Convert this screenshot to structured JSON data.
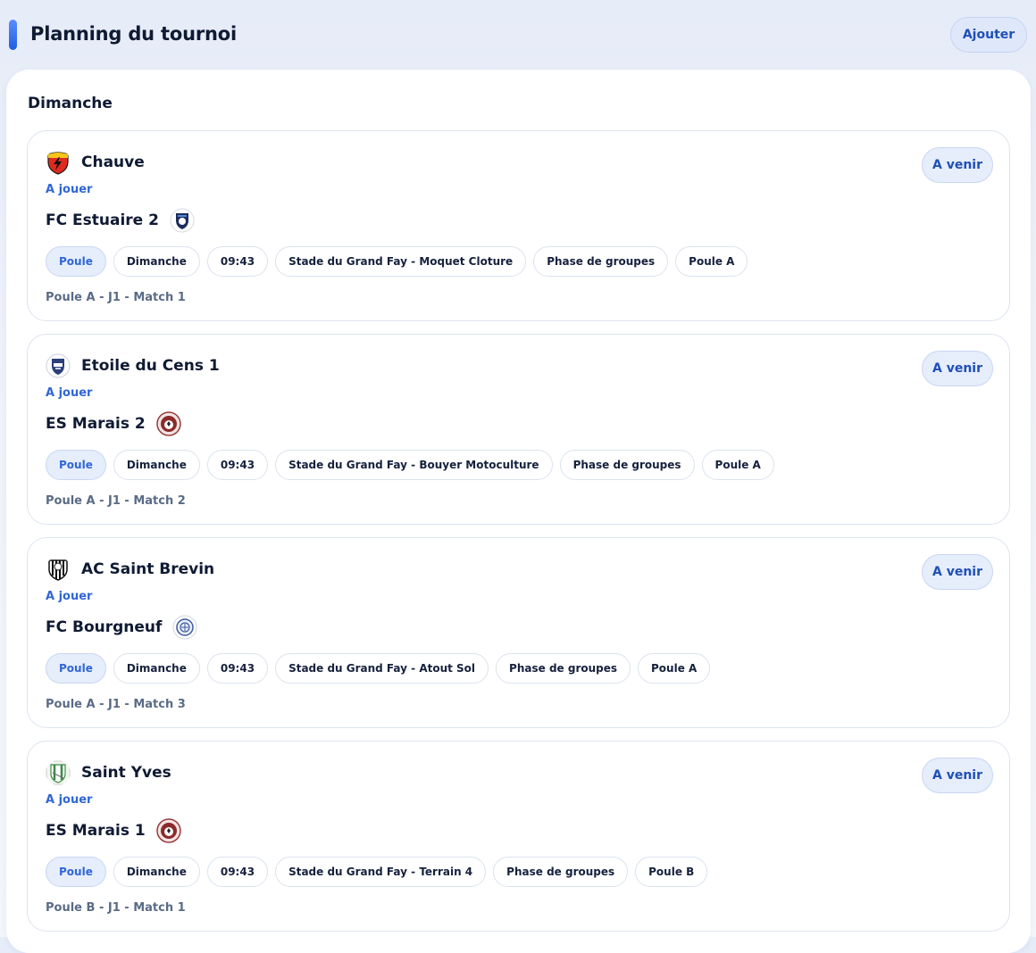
{
  "header": {
    "title": "Planning du tournoi",
    "add_label": "Ajouter"
  },
  "day": "Dimanche",
  "matches": [
    {
      "home": {
        "name": "Chauve",
        "logo": "red-shield-lightning-logo"
      },
      "status": "A jouer",
      "away": {
        "name": "FC Estuaire 2",
        "logo": "navy-crest-logo"
      },
      "badge": "A venir",
      "chips": [
        "Poule",
        "Dimanche",
        "09:43",
        "Stade du Grand Fay - Moquet Cloture",
        "Phase de groupes",
        "Poule A"
      ],
      "label": "Poule A - J1 - Match 1"
    },
    {
      "home": {
        "name": "Etoile du Cens 1",
        "logo": "blue-white-crest-logo"
      },
      "status": "A jouer",
      "away": {
        "name": "ES Marais 2",
        "logo": "maroon-ball-logo"
      },
      "badge": "A venir",
      "chips": [
        "Poule",
        "Dimanche",
        "09:43",
        "Stade du Grand Fay - Bouyer Motoculture",
        "Phase de groupes",
        "Poule A"
      ],
      "label": "Poule A - J1 - Match 2"
    },
    {
      "home": {
        "name": "AC Saint Brevin",
        "logo": "black-white-stripes-logo"
      },
      "status": "A jouer",
      "away": {
        "name": "FC Bourgneuf",
        "logo": "blue-circle-logo"
      },
      "badge": "A venir",
      "chips": [
        "Poule",
        "Dimanche",
        "09:43",
        "Stade du Grand Fay - Atout Sol",
        "Phase de groupes",
        "Poule A"
      ],
      "label": "Poule A - J1 - Match 3"
    },
    {
      "home": {
        "name": "Saint Yves",
        "logo": "green-white-crest-logo"
      },
      "status": "A jouer",
      "away": {
        "name": "ES Marais 1",
        "logo": "maroon-ball-logo"
      },
      "badge": "A venir",
      "chips": [
        "Poule",
        "Dimanche",
        "09:43",
        "Stade du Grand Fay - Terrain 4",
        "Phase de groupes",
        "Poule B"
      ],
      "label": "Poule B - J1 - Match 1"
    }
  ]
}
